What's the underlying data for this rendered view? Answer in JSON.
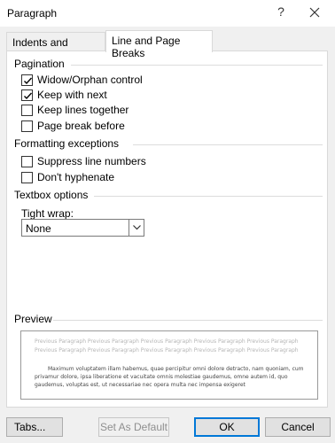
{
  "window": {
    "title": "Paragraph",
    "help_glyph": "?",
    "close_icon": "close-icon"
  },
  "tabs": [
    {
      "label": "Indents and Spacing",
      "active": false
    },
    {
      "label": "Line and Page Breaks",
      "active": true
    }
  ],
  "pagination": {
    "heading": "Pagination",
    "items": [
      {
        "label": "Widow/Orphan control",
        "checked": true
      },
      {
        "label": "Keep with next",
        "checked": true
      },
      {
        "label": "Keep lines together",
        "checked": false
      },
      {
        "label": "Page break before",
        "checked": false
      }
    ]
  },
  "formatting": {
    "heading": "Formatting exceptions",
    "items": [
      {
        "label": "Suppress line numbers",
        "checked": false
      },
      {
        "label": "Don't hyphenate",
        "checked": false
      }
    ]
  },
  "textbox": {
    "heading": "Textbox options",
    "tight_wrap_label": "Tight wrap:",
    "tight_wrap_value": "None"
  },
  "preview": {
    "heading": "Preview",
    "prev_line_1": "Previous Paragraph Previous Paragraph Previous Paragraph Previous Paragraph Previous Paragraph",
    "prev_line_2": "Previous Paragraph Previous Paragraph Previous Paragraph Previous Paragraph Previous Paragraph",
    "text_1": "Maximum voluptatem illam habemus, quae percipitur omni dolore detracto, nam quoniam, cum",
    "text_2": "privamur dolore, ipsa liberatione et vacuitate omnis molestiae gaudemus, omne autem id, quo",
    "text_3": "gaudemus, voluptas est, ut necessariae nec opera multa nec impensa exigeret"
  },
  "buttons": {
    "tabs": "Tabs...",
    "set_default": "Set As Default",
    "ok": "OK",
    "cancel": "Cancel"
  },
  "colors": {
    "ok_border": "#0078d7",
    "disabled_text": "#8f8f8f"
  }
}
